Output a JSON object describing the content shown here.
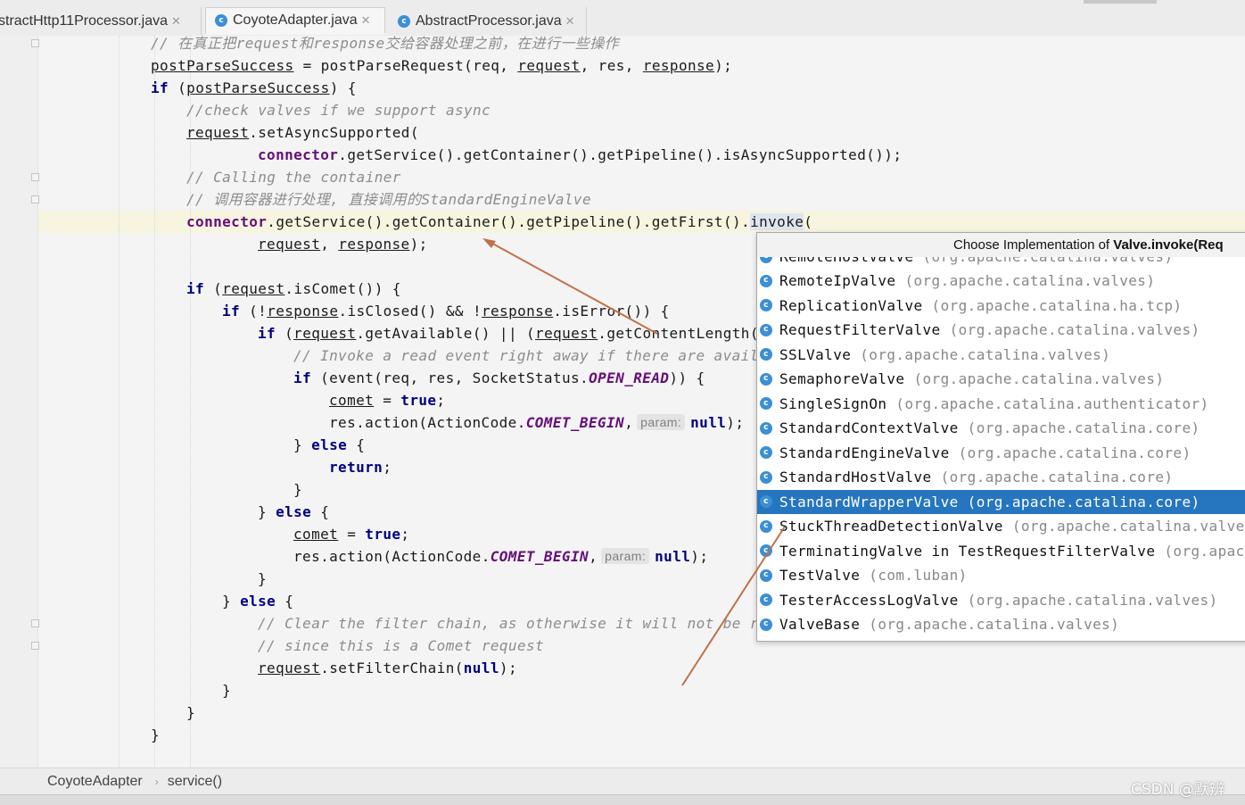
{
  "tabs": [
    {
      "label": "stractHttp11Processor.java",
      "active": false
    },
    {
      "label": "CoyoteAdapter.java",
      "active": true
    },
    {
      "label": "AbstractProcessor.java",
      "active": false
    }
  ],
  "code": {
    "l1": "// 在真正把request和response交给容器处理之前，在进行一些操作",
    "l2a": "postParseSuccess",
    "l2b": " = postParseRequest(req, ",
    "l2c": "request",
    "l2d": ", res, ",
    "l2e": "response",
    "l2f": ");",
    "l3a": "if",
    "l3b": " (",
    "l3c": "postParseSuccess",
    "l3d": ") {",
    "l4": "//check valves if we support async",
    "l5a": "request",
    "l5b": ".setAsyncSupported(",
    "l6a": "connector",
    "l6b": ".getService().getContainer().getPipeline().isAsyncSupported());",
    "l7": "// Calling the container",
    "l8": "// 调用容器进行处理, 直接调用的StandardEngineValve",
    "l9a": "connector",
    "l9b": ".getService().getContainer().getPipeline().getFirst().",
    "l9c": "invoke",
    "l9d": "(",
    "l10a": "request",
    "l10b": ", ",
    "l10c": "response",
    "l10d": ");",
    "l12a": "if",
    "l12b": " (",
    "l12c": "request",
    "l12d": ".isComet()) {",
    "l13a": "if",
    "l13b": " (!",
    "l13c": "response",
    "l13d": ".isClosed() && !",
    "l13e": "response",
    "l13f": ".isError()) {",
    "l14a": "if",
    "l14b": " (",
    "l14c": "request",
    "l14d": ".getAvailable() || (",
    "l14e": "request",
    "l14f": ".getContentLength(",
    "l15": "// Invoke a read event right away if there are avail",
    "l16a": "if",
    "l16b": " (event(req, res, SocketStatus.",
    "l16c": "OPEN_READ",
    "l16d": ")) {",
    "l17a": "comet",
    "l17b": " = ",
    "l17c": "true",
    "l17d": ";",
    "l18a": "res.action(ActionCode.",
    "l18b": "COMET_BEGIN",
    "l18c": ",",
    "l18hint": "param:",
    "l18d": "null",
    "l18e": ");",
    "l19a": "} ",
    "l19b": "else",
    "l19c": " {",
    "l20a": "return",
    "l20b": ";",
    "l21": "}",
    "l22a": "} ",
    "l22b": "else",
    "l22c": " {",
    "l23a": "comet",
    "l23b": " = ",
    "l23c": "true",
    "l23d": ";",
    "l24a": "res.action(ActionCode.",
    "l24b": "COMET_BEGIN",
    "l24c": ",",
    "l24hint": "param:",
    "l24d": "null",
    "l24e": ");",
    "l25": "}",
    "l26a": "} ",
    "l26b": "else",
    "l26c": " {",
    "l27": "// Clear the filter chain, as otherwise it will not be r",
    "l28": "// since this is a Comet request",
    "l29a": "request",
    "l29b": ".setFilterChain(",
    "l29c": "null",
    "l29d": ");",
    "l30": "}",
    "l31": "}",
    "l32": "}"
  },
  "popup": {
    "title_prefix": "Choose Implementation of ",
    "title_bold": "Valve.invoke(Req",
    "partial_item": {
      "name": "RemoteHostValve",
      "pkg": "(org.apache.catalina.valves)"
    },
    "items": [
      {
        "name": "RemoteIpValve",
        "pkg": "(org.apache.catalina.valves)"
      },
      {
        "name": "ReplicationValve",
        "pkg": "(org.apache.catalina.ha.tcp)"
      },
      {
        "name": "RequestFilterValve",
        "pkg": "(org.apache.catalina.valves)"
      },
      {
        "name": "SSLValve",
        "pkg": "(org.apache.catalina.valves)"
      },
      {
        "name": "SemaphoreValve",
        "pkg": "(org.apache.catalina.valves)"
      },
      {
        "name": "SingleSignOn",
        "pkg": "(org.apache.catalina.authenticator)"
      },
      {
        "name": "StandardContextValve",
        "pkg": "(org.apache.catalina.core)"
      },
      {
        "name": "StandardEngineValve",
        "pkg": "(org.apache.catalina.core)"
      },
      {
        "name": "StandardHostValve",
        "pkg": "(org.apache.catalina.core)"
      },
      {
        "name": "StandardWrapperValve",
        "pkg": "(org.apache.catalina.core)"
      },
      {
        "name": "StuckThreadDetectionValve",
        "pkg": "(org.apache.catalina.valves)"
      },
      {
        "name": "TerminatingValve in TestRequestFilterValve",
        "pkg": "(org.apach"
      },
      {
        "name": "TestValve",
        "pkg": "(com.luban)"
      },
      {
        "name": "TesterAccessLogValve",
        "pkg": "(org.apache.catalina.valves)"
      },
      {
        "name": "ValveBase",
        "pkg": "(org.apache.catalina.valves)"
      }
    ],
    "selected_index": 9,
    "icon_letter": "c"
  },
  "breadcrumb": {
    "class_name": "CoyoteAdapter",
    "method_name": "service()"
  },
  "watermark": "CSDN @默辨",
  "colors": {
    "keyword": "#000080",
    "field": "#660e7a",
    "comment": "#8c8c8c",
    "selection": "#2675bf",
    "annotation_arrow": "#c0714a"
  }
}
